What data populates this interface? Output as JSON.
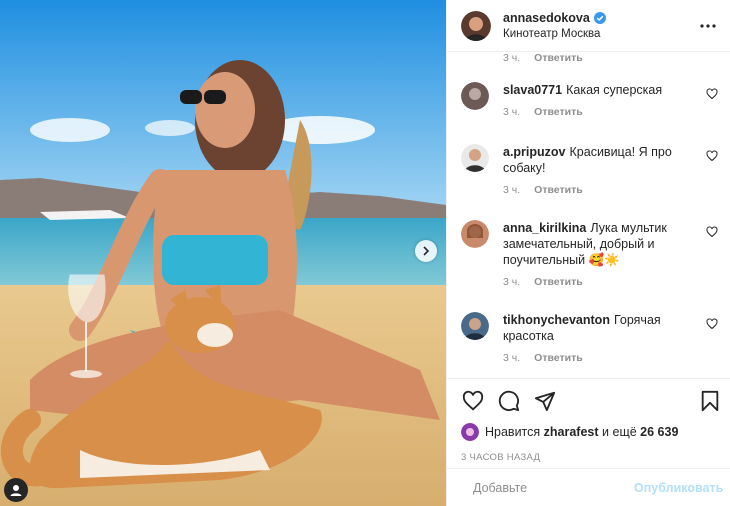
{
  "post": {
    "username": "annasedokova",
    "location": "Кинотеатр Москва",
    "verified": true
  },
  "previous_comment_meta": {
    "time": "3 ч.",
    "reply": "Ответить"
  },
  "comments": [
    {
      "user": "slava0771",
      "text": "Какая суперская",
      "time": "3 ч.",
      "reply": "Ответить",
      "avatar_color": "#6b5a55"
    },
    {
      "user": "a.pripuzov",
      "text": "Красивица! Я про собаку!",
      "time": "3 ч.",
      "reply": "Ответить",
      "avatar_color": "#3a3a3a"
    },
    {
      "user": "anna_kirilkina",
      "text": "Лука мультик замечательный, добрый и поучительный 🥰☀️",
      "time": "3 ч.",
      "reply": "Ответить",
      "avatar_color": "#c98a6b"
    },
    {
      "user": "tikhonychevanton",
      "text": "Горячая красотка",
      "time": "3 ч.",
      "reply": "Ответить",
      "avatar_color": "#4a6a8a"
    }
  ],
  "likes": {
    "prefix": "Нравится",
    "user": "zharafest",
    "suffix": "и ещё",
    "count": "26 639"
  },
  "time_ago": "3 ЧАСОВ НАЗАД",
  "comment_box": {
    "placeholder": "Добавьте",
    "publish_label": "Опубликовать"
  },
  "icons": {
    "more": "more-dots-icon",
    "like": "heart-icon",
    "comment": "comment-bubble-icon",
    "share": "paper-plane-icon",
    "save": "bookmark-icon",
    "emoji": "smiley-icon",
    "next": "chevron-right-icon",
    "tag": "user-tag-icon"
  },
  "colors": {
    "link_blue": "#b2dffc",
    "verified_blue": "#3897f0",
    "muted": "#8e8e8e"
  }
}
